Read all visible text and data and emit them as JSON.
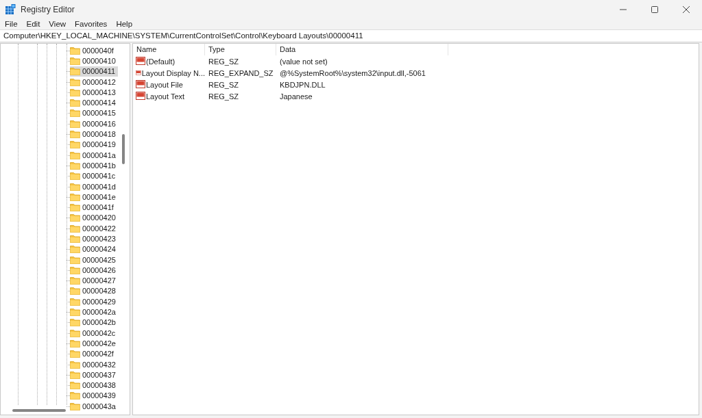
{
  "window": {
    "title": "Registry Editor"
  },
  "menu": [
    "File",
    "Edit",
    "View",
    "Favorites",
    "Help"
  ],
  "address": "Computer\\HKEY_LOCAL_MACHINE\\SYSTEM\\CurrentControlSet\\Control\\Keyboard Layouts\\00000411",
  "tree": [
    {
      "label": "0000040f",
      "selected": false
    },
    {
      "label": "00000410",
      "selected": false
    },
    {
      "label": "00000411",
      "selected": true
    },
    {
      "label": "00000412",
      "selected": false
    },
    {
      "label": "00000413",
      "selected": false
    },
    {
      "label": "00000414",
      "selected": false
    },
    {
      "label": "00000415",
      "selected": false
    },
    {
      "label": "00000416",
      "selected": false
    },
    {
      "label": "00000418",
      "selected": false
    },
    {
      "label": "00000419",
      "selected": false
    },
    {
      "label": "0000041a",
      "selected": false
    },
    {
      "label": "0000041b",
      "selected": false
    },
    {
      "label": "0000041c",
      "selected": false
    },
    {
      "label": "0000041d",
      "selected": false
    },
    {
      "label": "0000041e",
      "selected": false
    },
    {
      "label": "0000041f",
      "selected": false
    },
    {
      "label": "00000420",
      "selected": false
    },
    {
      "label": "00000422",
      "selected": false
    },
    {
      "label": "00000423",
      "selected": false
    },
    {
      "label": "00000424",
      "selected": false
    },
    {
      "label": "00000425",
      "selected": false
    },
    {
      "label": "00000426",
      "selected": false
    },
    {
      "label": "00000427",
      "selected": false
    },
    {
      "label": "00000428",
      "selected": false
    },
    {
      "label": "00000429",
      "selected": false
    },
    {
      "label": "0000042a",
      "selected": false
    },
    {
      "label": "0000042b",
      "selected": false
    },
    {
      "label": "0000042c",
      "selected": false
    },
    {
      "label": "0000042e",
      "selected": false
    },
    {
      "label": "0000042f",
      "selected": false
    },
    {
      "label": "00000432",
      "selected": false
    },
    {
      "label": "00000437",
      "selected": false
    },
    {
      "label": "00000438",
      "selected": false
    },
    {
      "label": "00000439",
      "selected": false
    },
    {
      "label": "0000043a",
      "selected": false
    }
  ],
  "table": {
    "columns": [
      "Name",
      "Type",
      "Data"
    ],
    "rows": [
      [
        "(Default)",
        "REG_SZ",
        "(value not set)"
      ],
      [
        "Layout Display N...",
        "REG_EXPAND_SZ",
        "@%SystemRoot%\\system32\\input.dll,-5061"
      ],
      [
        "Layout File",
        "REG_SZ",
        "KBDJPN.DLL"
      ],
      [
        "Layout Text",
        "REG_SZ",
        "Japanese"
      ]
    ]
  }
}
